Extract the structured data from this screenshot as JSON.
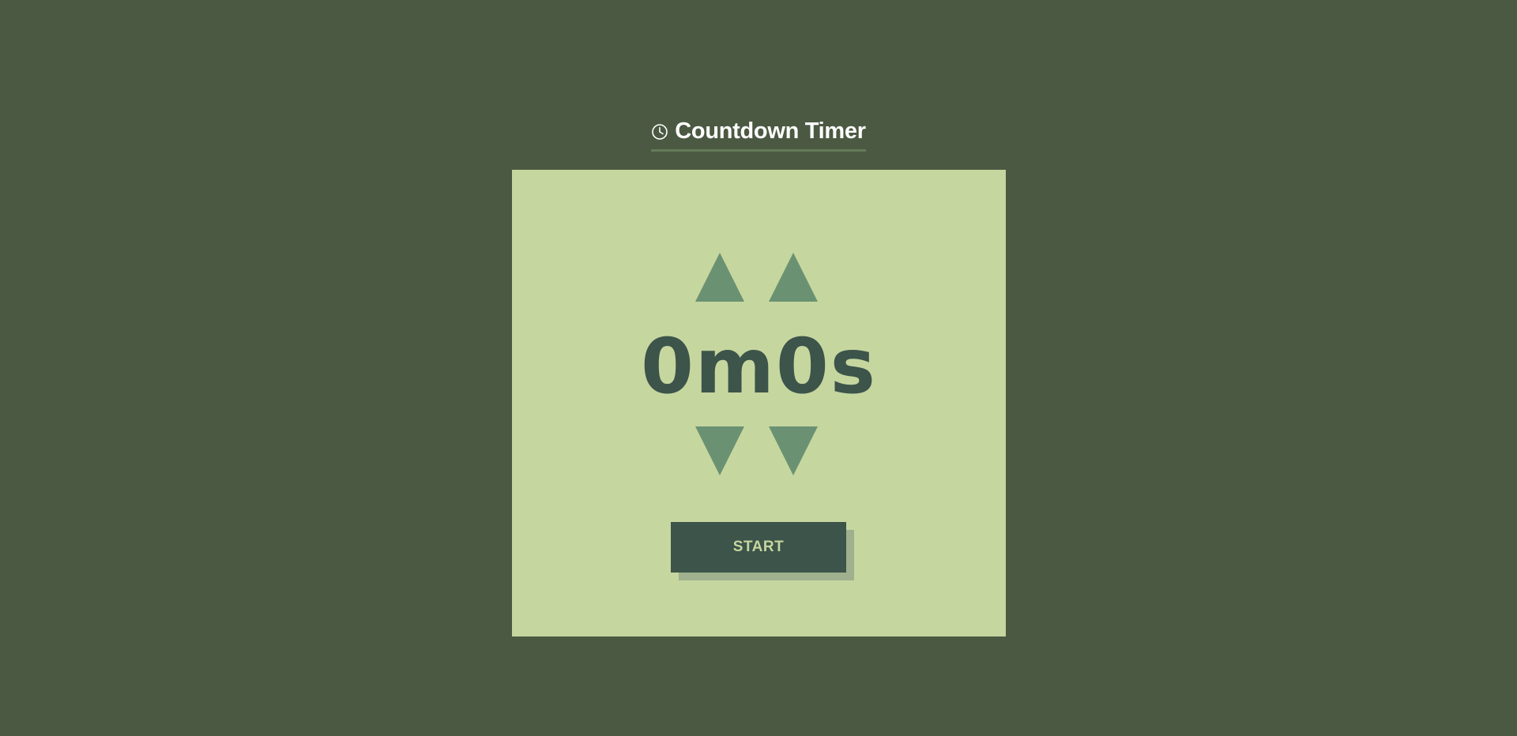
{
  "header": {
    "title": "Countdown Timer",
    "icon": "clock-icon"
  },
  "timer": {
    "display": "0m0s",
    "minutes": 0,
    "seconds": 0,
    "controls": {
      "minutes_up_icon": "triangle-up-icon",
      "seconds_up_icon": "triangle-up-icon",
      "minutes_down_icon": "triangle-down-icon",
      "seconds_down_icon": "triangle-down-icon"
    }
  },
  "actions": {
    "start_label": "START"
  },
  "colors": {
    "background": "#4b5942",
    "card": "#c6d69f",
    "arrow": "#6a9272",
    "text_dark": "#3c544a",
    "title_text": "#ffffff",
    "title_underline": "#647a5a",
    "button_shadow": "#9fb08e"
  }
}
